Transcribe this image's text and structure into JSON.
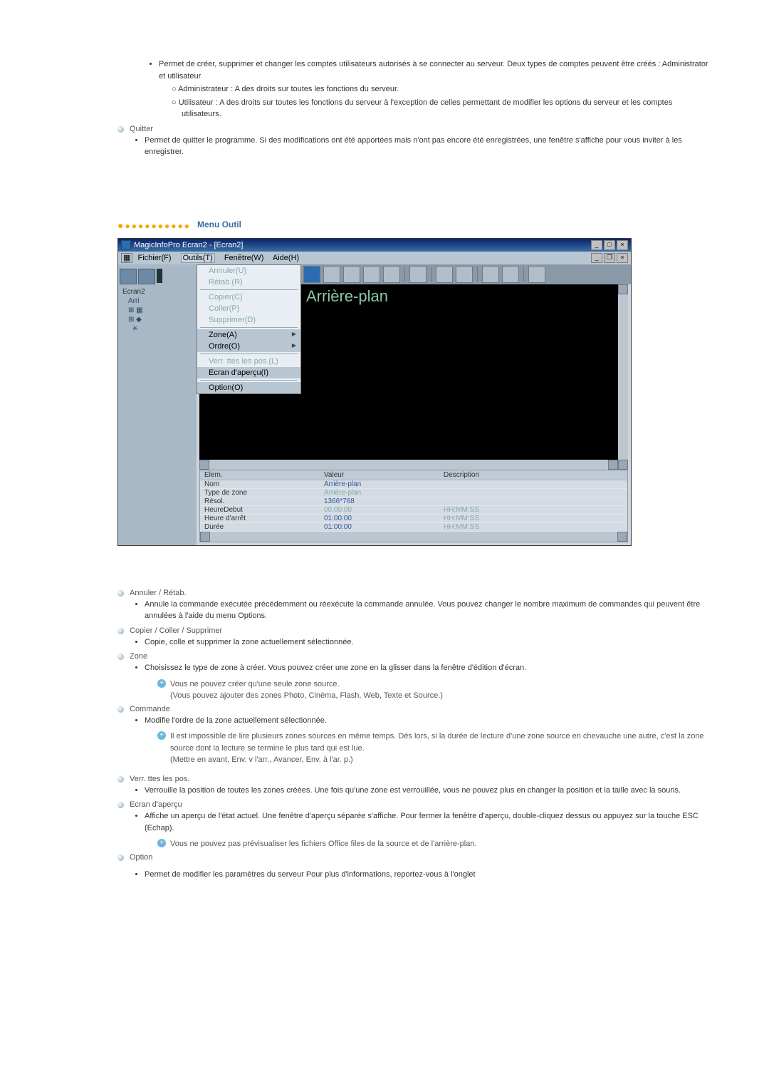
{
  "top_section": {
    "bullet1": "Permet de créer, supprimer et changer les comptes utilisateurs autorisés à se connecter au serveur. Deux types de comptes peuvent être créés : Administrator et utilisateur",
    "sub_admin": "Administrateur : A des droits sur toutes les fonctions du serveur.",
    "sub_user": "Utilisateur : A des droits sur toutes les fonctions du serveur à l'exception de celles permettant de modifier les options du serveur et les comptes utilisateurs.",
    "quitter_title": "Quitter",
    "quitter_body": "Permet de quitter le programme. Si des modifications ont été apportées mais n'ont pas encore été enregistrées, une fenêtre s'affiche pour vous inviter à les enregistrer."
  },
  "section_header": "Menu Outil",
  "screenshot": {
    "window_title": "MagicInfoPro Ecran2 - [Ecran2]",
    "menubar": {
      "file": "Fichier(F)",
      "tools": "Outils(T)",
      "window": "Fenêtre(W)",
      "help": "Aide(H)"
    },
    "tree": {
      "n0": "Ecran2",
      "n1": "Arri"
    },
    "dropdown": {
      "undo": "Annuler(U)",
      "redo": "Rétab.(R)",
      "copy": "Copier(C)",
      "paste": "Coller(P)",
      "delete": "Supprimer(D)",
      "zone": "Zone(A)",
      "order": "Ordre(O)",
      "lock": "Verr. ttes les pos.(L)",
      "preview": "Ecran d'aperçu(I)",
      "option": "Option(O)"
    },
    "canvas_label": "Arrière-plan",
    "table": {
      "h_elem": "Elem.",
      "h_val": "Valeur",
      "h_desc": "Description",
      "r0_e": "Nom",
      "r0_v": "Arrière-plan",
      "r0_d": "",
      "r1_e": "Type de zone",
      "r1_v": "Arrière-plan",
      "r1_d": "",
      "r2_e": "Résol.",
      "r2_v": "1366*768",
      "r2_d": "",
      "r3_e": "HeureDebut",
      "r3_v": "00:00:00",
      "r3_d": "HH:MM:SS",
      "r4_e": "Heure d'arrêt",
      "r4_v": "01:00:00",
      "r4_d": "HH:MM:SS",
      "r5_e": "Durée",
      "r5_v": "01:00:00",
      "r5_d": "HH:MM:SS"
    }
  },
  "body": {
    "annuler": {
      "title": "Annuler / Rétab.",
      "text": "Annule la commande exécutée précédemment ou réexécute la commande annulée. Vous pouvez changer le nombre maximum de commandes qui peuvent être annulées à l'aide du menu Options."
    },
    "copier": {
      "title": "Copier / Coller / Supprimer",
      "text": "Copie, colle et supprimer la zone actuellement sélectionnée."
    },
    "zone": {
      "title": "Zone",
      "text": "Choisissez le type de zone à créer. Vous pouvez créer une zone en la glisser dans la fenêtre d'édition d'écran.",
      "tip1": "Vous ne pouvez créer qu'une seule zone source.",
      "tip1b": "(Vous pouvez ajouter des zones Photo, Cinéma, Flash, Web, Texte et Source.)"
    },
    "commande": {
      "title": "Commande",
      "text": "Modifie l'ordre de la zone actuellement sélectionnée.",
      "tip": "Il est impossible de lire plusieurs zones sources en même temps. Dès lors, si la durée de lecture d'une zone source en chevauche une autre, c'est la zone source dont la lecture se termine le plus tard qui est lue.",
      "tipb": "(Mettre en avant, Env. v l'arr., Avancer, Env. à l'ar. p.)"
    },
    "verr": {
      "title": "Verr. ttes les pos.",
      "text": "Verrouille la position de toutes les zones créées. Une fois qu'une zone est verrouillée, vous ne pouvez plus en changer la position et la taille avec la souris."
    },
    "apercu": {
      "title": "Ecran d'aperçu",
      "text": "Affiche un aperçu de l'état actuel. Une fenêtre d'aperçu séparée s'affiche. Pour fermer la fenêtre d'aperçu, double-cliquez dessus ou appuyez sur la touche ESC (Echap).",
      "tip": "Vous ne pouvez pas prévisualiser les fichiers Office files de la source et de l'arrière-plan."
    },
    "option": {
      "title": "Option",
      "text": "Permet de modifier les paramètres du serveur Pour plus d'informations, reportez-vous à l'onglet"
    }
  }
}
